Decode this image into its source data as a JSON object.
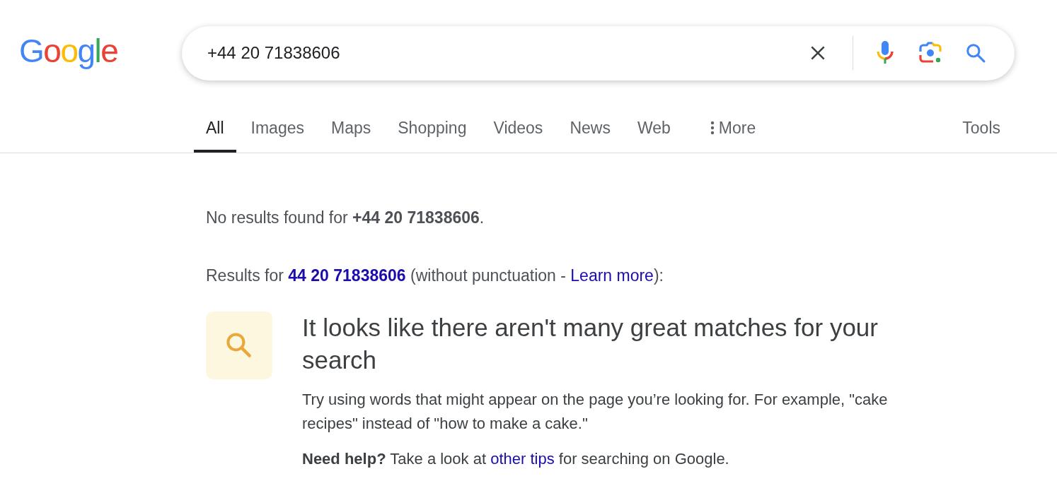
{
  "logo": "Google",
  "search": {
    "value": "+44 20 71838606"
  },
  "tabs": [
    {
      "label": "All",
      "selected": true
    },
    {
      "label": "Images",
      "selected": false
    },
    {
      "label": "Maps",
      "selected": false
    },
    {
      "label": "Shopping",
      "selected": false
    },
    {
      "label": "Videos",
      "selected": false
    },
    {
      "label": "News",
      "selected": false
    },
    {
      "label": "Web",
      "selected": false
    },
    {
      "label": "More",
      "selected": false,
      "kind": "menu"
    }
  ],
  "tools": "Tools",
  "no_results": "No results found for **+44 20 71838606**.",
  "results_for": {
    "prefix": "Results for",
    "query": "44 20 71838606",
    "middle": "(without punctuation -",
    "link": "Learn more",
    "suffix": "):"
  },
  "tip": {
    "heading": "It looks like there aren't many great matches for your search",
    "body": "Try using words that might appear on the page you’re looking for. For example, \"cake recipes\" instead of \"how to make a cake.\"",
    "help_bold": "Need help?",
    "help_before": "Take a look at",
    "help_link": "other tips",
    "help_after": "for searching on Google."
  }
}
